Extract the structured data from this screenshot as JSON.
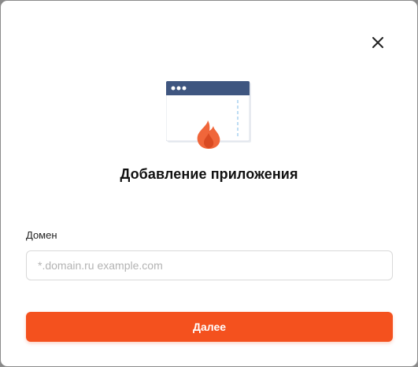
{
  "dialog": {
    "title": "Добавление приложения",
    "close_icon": "close-icon",
    "illustration_icon": "browser-window-fire-icon"
  },
  "form": {
    "domain_label": "Домен",
    "domain_placeholder": "*.domain.ru example.com",
    "domain_value": "",
    "submit_label": "Далее"
  },
  "colors": {
    "accent": "#f4511e",
    "window_header": "#3f5680",
    "flame_outer": "#f0663a",
    "flame_inner": "#d94a22",
    "dashed_line": "#a9d2f0"
  }
}
